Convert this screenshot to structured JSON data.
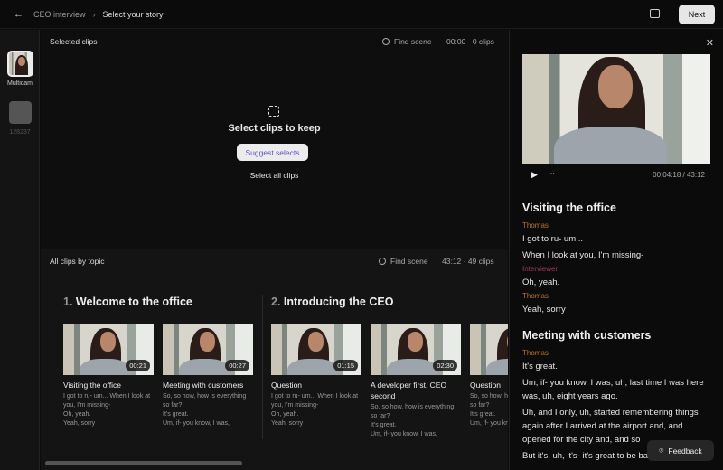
{
  "topbar": {
    "breadcrumb": [
      "CEO interview",
      "Select your story"
    ],
    "next_label": "Next"
  },
  "rail": {
    "items": [
      {
        "label": "Multicam"
      },
      {
        "label": "128237"
      }
    ]
  },
  "selected": {
    "title": "Selected clips",
    "find": "Find scene",
    "summary": "00:00 · 0 clips",
    "empty_title": "Select clips to keep",
    "suggest_label": "Suggest selects",
    "select_all_label": "Select all clips"
  },
  "all": {
    "title": "All clips by topic",
    "find": "Find scene",
    "summary": "43:12 · 49 clips",
    "topics": [
      {
        "num": "1.",
        "title": "Welcome to the office"
      },
      {
        "num": "2.",
        "title": "Introducing the CEO"
      }
    ],
    "clips": [
      {
        "duration": "00:21",
        "title": "Visiting the office",
        "text": "I got to ru- um... When I look at you, I'm missing-\nOh, yeah.\nYeah, sorry"
      },
      {
        "duration": "00:27",
        "title": "Meeting with customers",
        "text": "So, so how, how is everything so far?\nIt's great.\nUm, if- you know, I was,"
      },
      {
        "duration": "01:15",
        "title": "Question",
        "text": "I got to ru- um... When I look at you, I'm missing-\nOh, yeah.\nYeah, sorry"
      },
      {
        "duration": "02:30",
        "title": "A developer first, CEO second",
        "text": "So, so how, how is everything so far?\nIt's great.\nUm, if- you know, I was,"
      },
      {
        "duration": "",
        "title": "Question",
        "text": "So, so how, how is everything so far?\nIt's great.\nUm, if- you know, I was,"
      }
    ]
  },
  "player": {
    "time": "00:04:18 / 43:12"
  },
  "transcript": [
    {
      "heading": "Visiting the office",
      "blocks": [
        {
          "speaker": "Thomas",
          "color": "#b8742e",
          "lines": [
            "I got to ru- um...",
            "When I look at you, I'm missing-"
          ]
        },
        {
          "speaker": "Interviewer",
          "color": "#a8325e",
          "lines": [
            "Oh, yeah."
          ]
        },
        {
          "speaker": "Thomas",
          "color": "#b8742e",
          "lines": [
            "Yeah, sorry"
          ]
        }
      ]
    },
    {
      "heading": "Meeting with customers",
      "blocks": [
        {
          "speaker": "Thomas",
          "color": "#b8742e",
          "lines": [
            "It's great.",
            "Um, if- you know, I was, uh, last time I was here was, uh, eight years ago.",
            "Uh, and I only, uh, started remembering things again after I arrived at the airport and, and opened for the city and, and so",
            "But it's, uh, it's- it's great to be back, um"
          ]
        }
      ]
    }
  ],
  "feedback_label": "Feedback"
}
